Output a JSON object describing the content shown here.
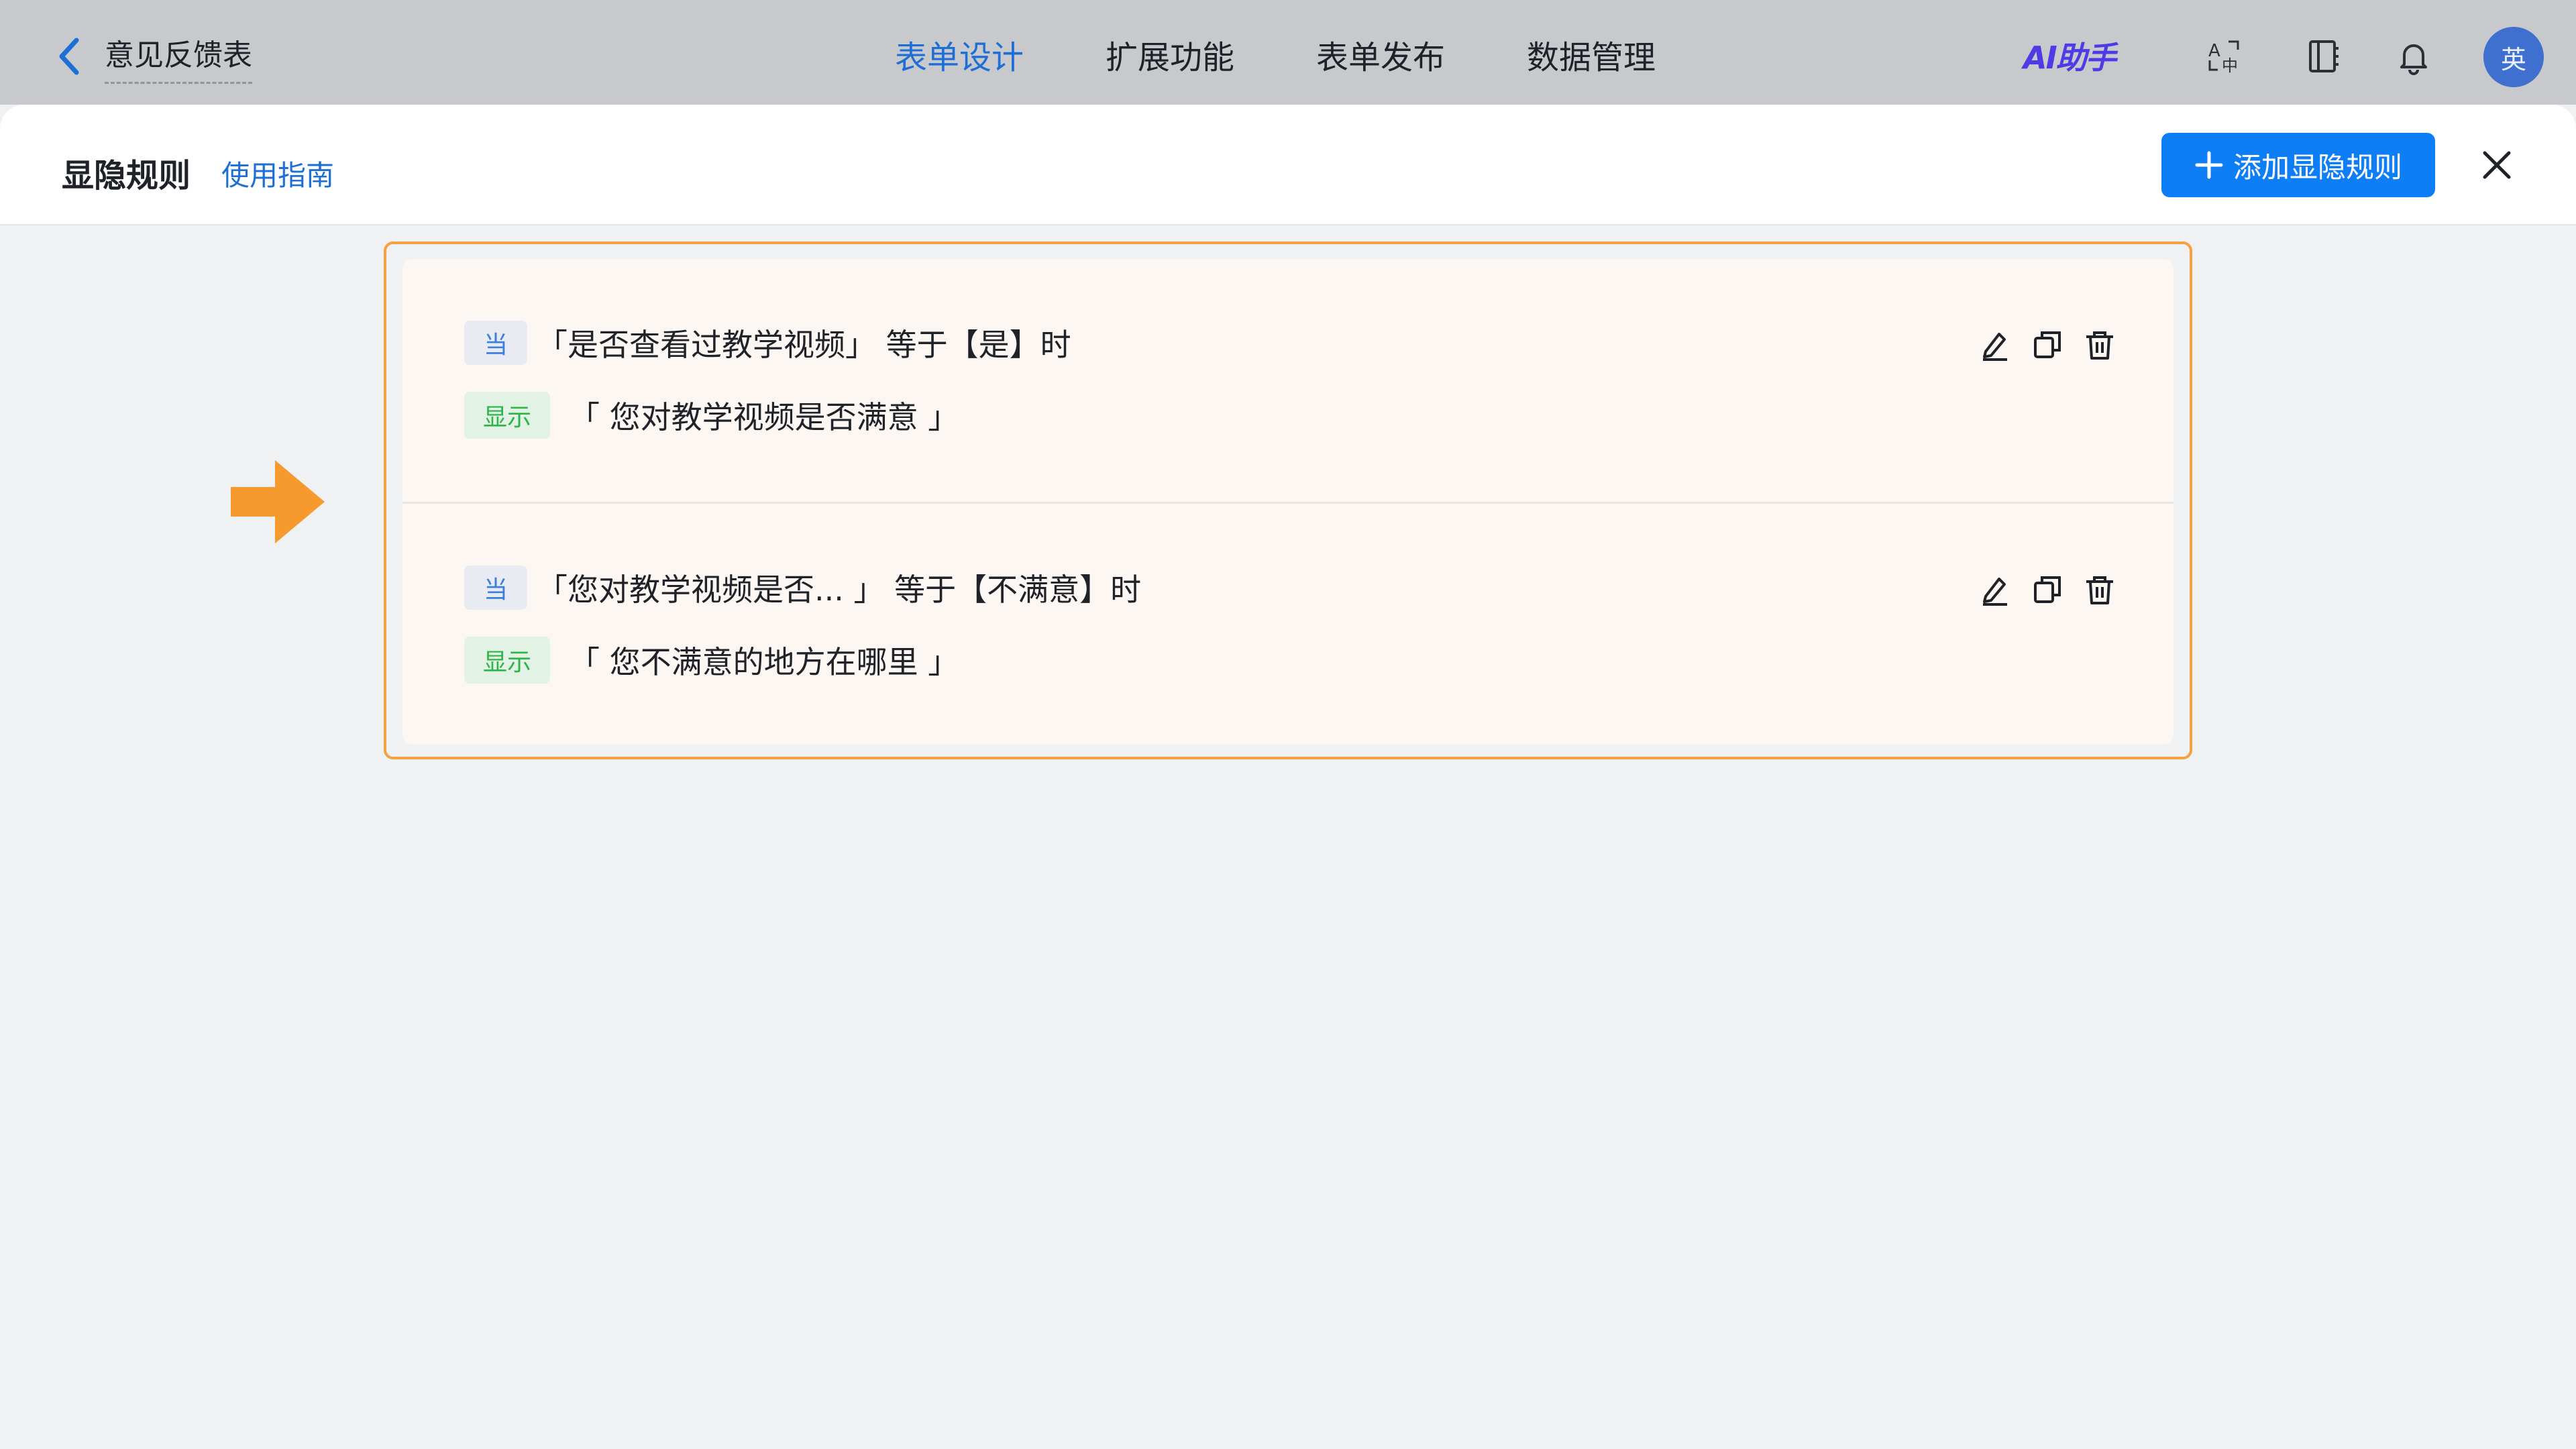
{
  "header": {
    "form_title": "意见反馈表",
    "tabs": [
      {
        "label": "表单设计",
        "active": true
      },
      {
        "label": "扩展功能",
        "active": false
      },
      {
        "label": "表单发布",
        "active": false
      },
      {
        "label": "数据管理",
        "active": false
      }
    ],
    "ai_label": "AI助手",
    "avatar_text": "英"
  },
  "panel": {
    "title": "显隐规则",
    "guide_link": "使用指南",
    "add_button_label": "添加显隐规则"
  },
  "rules": [
    {
      "when_tag": "当",
      "condition": "「是否查看过教学视频」 等于【是】时",
      "show_tag": "显示",
      "target": "「 您对教学视频是否满意 」"
    },
    {
      "when_tag": "当",
      "condition": "「您对教学视频是否... 」 等于【不满意】时",
      "show_tag": "显示",
      "target": "「 您不满意的地方在哪里 」"
    }
  ],
  "colors": {
    "accent": "#1d6fd6",
    "primary_button": "#0e7ef6",
    "highlight_border": "#f4a043",
    "arrow": "#f79a2e",
    "show_tag_text": "#2db54a",
    "when_tag_text": "#3d7fdc"
  },
  "icons": {
    "back": "chevron-left-icon",
    "translate": "translate-icon",
    "notebook": "notebook-icon",
    "bell": "bell-icon",
    "close": "close-icon",
    "edit": "edit-icon",
    "copy": "copy-icon",
    "delete": "trash-icon"
  }
}
